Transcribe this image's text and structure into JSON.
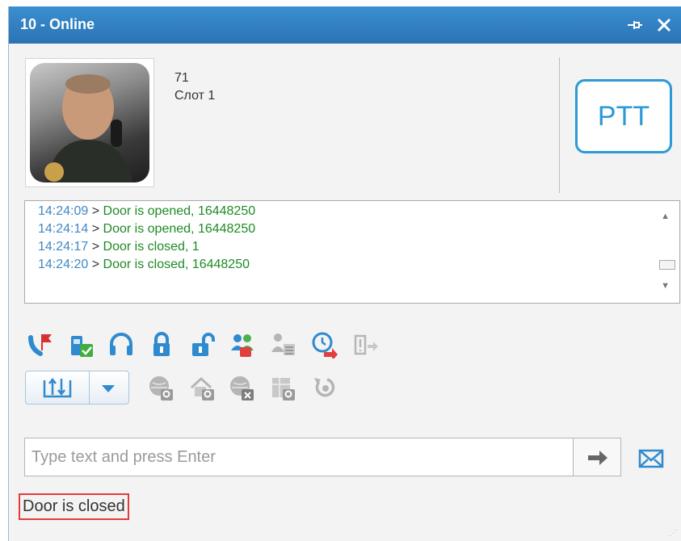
{
  "window": {
    "title": "10 - Online"
  },
  "subscriber": {
    "id": "71",
    "slot": "Слот 1"
  },
  "ptt": {
    "label": "PTT"
  },
  "log": {
    "lines": [
      {
        "time": "14:24:09",
        "sep": ">",
        "text": "Door is opened, 16448250"
      },
      {
        "time": "14:24:14",
        "sep": ">",
        "text": "Door is opened, 16448250"
      },
      {
        "time": "14:24:17",
        "sep": ">",
        "text": "Door is closed, 1"
      },
      {
        "time": "14:24:20",
        "sep": ">",
        "text": "Door is closed, 16448250"
      }
    ]
  },
  "toolbar": {
    "row1": [
      "call-alert-flag-icon",
      "remote-monitor-radio-icon",
      "headset-icon",
      "lock-icon",
      "unlock-icon",
      "group-call-icon",
      "user-list-icon",
      "schedule-forward-icon",
      "door-exit-icon"
    ],
    "row2": [
      "location-query-globe-icon",
      "home-query-icon",
      "location-cancel-globe-icon",
      "map-query-icon",
      "reset-icon"
    ]
  },
  "message": {
    "placeholder": "Type text and press Enter"
  },
  "status": {
    "text": "Door is closed"
  },
  "colors": {
    "accent": "#2b9ad6",
    "timestamp": "#3f88c5",
    "message": "#1e8a24",
    "titlebar": "#2b73b4",
    "highlight": "#e23b3b"
  }
}
